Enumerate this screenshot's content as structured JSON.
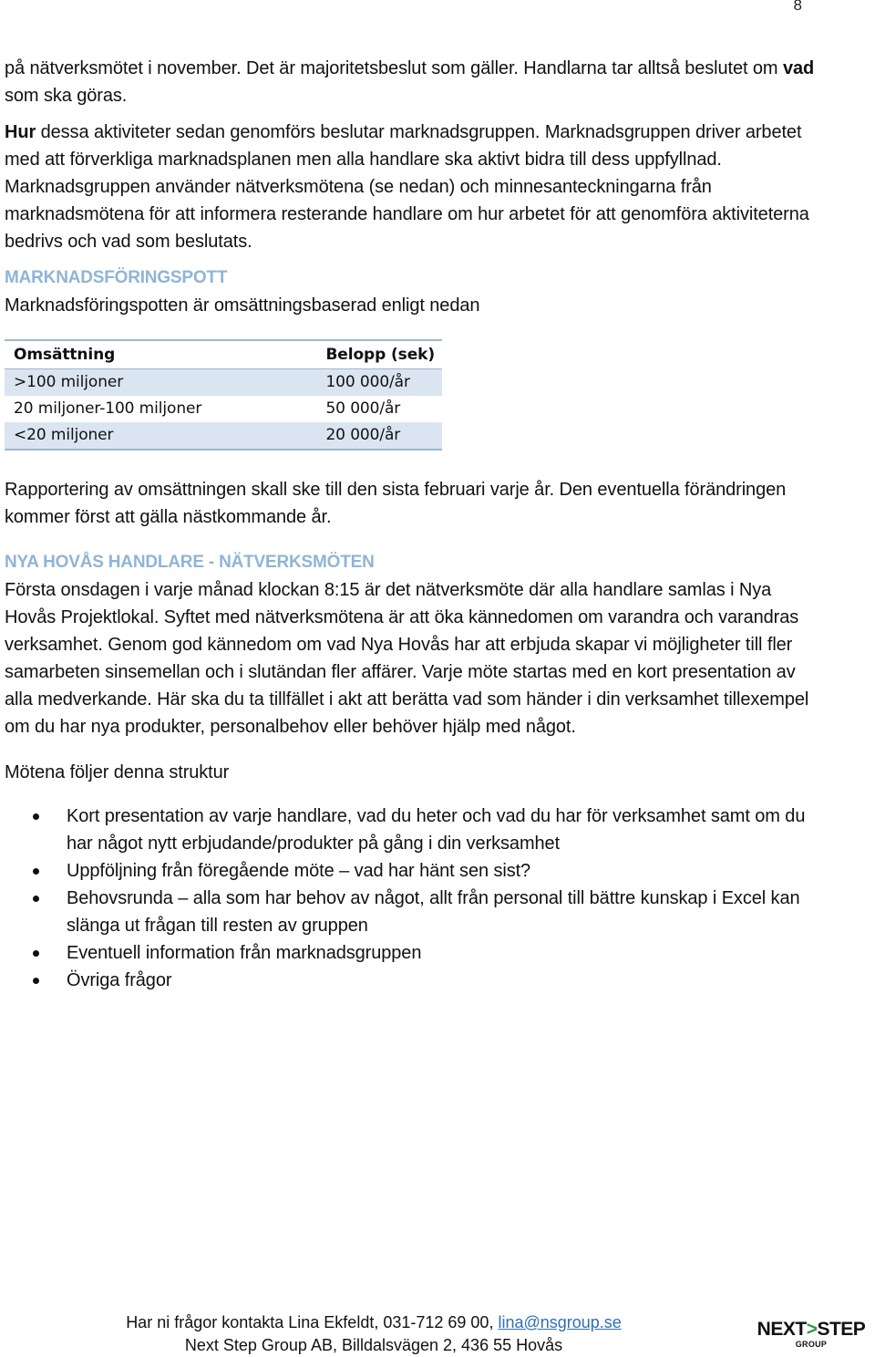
{
  "page": {
    "number": "8"
  },
  "intro": {
    "p1_line": "på nätverksmötet i november. Det är majoritetsbeslut som gäller. Handlarna tar alltså beslutet om ",
    "p1_bold": "vad",
    "p1_tail": " som ska göras.",
    "p2_bold": "Hur",
    "p2_text": " dessa aktiviteter sedan genomförs beslutar marknadsgruppen. Marknadsgruppen driver arbetet med att förverkliga marknadsplanen men alla handlare ska aktivt bidra till dess uppfyllnad. Marknadsgruppen använder nätverksmötena (se nedan) och minnesanteckningarna från marknadsmötena för att informera resterande handlare om hur arbetet för att genomföra aktiviteterna bedrivs och vad som beslutats."
  },
  "pot_section": {
    "heading": "MARKNADSFÖRINGSPOTT",
    "intro": "Marknadsföringspotten är omsättningsbaserad enligt nedan",
    "table": {
      "headers": [
        "Omsättning",
        "Belopp (sek)"
      ],
      "rows": [
        [
          ">100 miljoner",
          "100 000/år"
        ],
        [
          "20 miljoner-100 miljoner",
          "50 000/år"
        ],
        [
          "<20 miljoner",
          "20 000/år"
        ]
      ]
    },
    "after_table": "Rapportering av omsättningen skall ske till den sista februari varje år.  Den eventuella förändringen kommer först att gälla nästkommande år."
  },
  "network_section": {
    "heading": "NYA HOVÅS HANDLARE - NÄTVERKSMÖTEN",
    "body": "Första onsdagen i varje månad klockan 8:15 är det nätverksmöte där alla handlare samlas i Nya Hovås Projektlokal. Syftet med nätverksmötena är att öka kännedomen om varandra och varandras verksamhet. Genom god kännedom om vad Nya Hovås har att erbjuda skapar vi möjligheter till fler samarbeten sinsemellan och i slutändan fler affärer. Varje möte startas med en kort presentation av alla medverkande. Här ska du ta tillfället i akt att berätta vad som händer i din verksamhet tillexempel om du har nya produkter, personalbehov eller behöver hjälp med något.",
    "structure_intro": "Mötena följer denna struktur",
    "structure_items": [
      "Kort presentation av varje handlare, vad du heter och vad du har för verksamhet samt om du har något nytt erbjudande/produkter på gång i din verksamhet",
      "Uppföljning från föregående möte – vad har hänt sen sist?",
      "Behovsrunda – alla som har behov av något, allt från personal till bättre kunskap i Excel kan slänga ut frågan till resten av gruppen",
      "Eventuell information från marknadsgruppen",
      "Övriga frågor"
    ]
  },
  "footer": {
    "contact_text": "Har ni frågor kontakta Lina Ekfeldt, 031-712 69 00, ",
    "email": "lina@nsgroup.se",
    "address": "Next Step Group AB, Billdalsvägen 2, 436 55 Hovås"
  },
  "logo": {
    "word1": "NEXT",
    "arrow": ">",
    "word2": "STEP",
    "sub": "GROUP",
    "arrow_color": "#2e9a3c"
  },
  "colors": {
    "heading": "#8fb4d6",
    "table_shade": "#dbe5f1",
    "table_rule": "#9fb6cc",
    "link": "#2f6fb5"
  }
}
